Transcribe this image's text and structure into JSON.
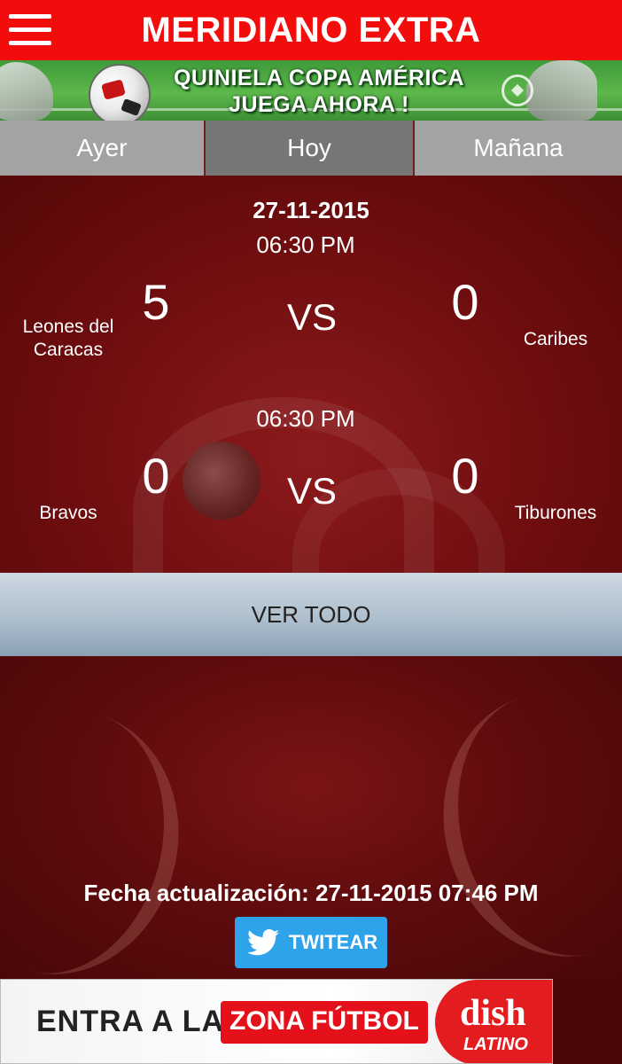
{
  "app": {
    "title": "MERIDIANO EXTRA"
  },
  "promo": {
    "line1": "QUINIELA COPA AMÉRICA",
    "line2": "JUEGA AHORA !"
  },
  "tabs": [
    {
      "label": "Ayer",
      "active": false
    },
    {
      "label": "Hoy",
      "active": true
    },
    {
      "label": "Mañana",
      "active": false
    }
  ],
  "date": "27-11-2015",
  "matches": [
    {
      "time": "06:30 PM",
      "home_team": "Leones del Caracas",
      "home_score": "5",
      "vs": "VS",
      "away_score": "0",
      "away_team": "Caribes"
    },
    {
      "time": "06:30 PM",
      "home_team": "Bravos",
      "home_score": "0",
      "vs": "VS",
      "away_score": "0",
      "away_team": "Tiburones"
    }
  ],
  "ver_todo": "VER TODO",
  "update": "Fecha actualización: 27-11-2015 07:46 PM",
  "twitter": {
    "label": "TWITEAR",
    "icon": "twitter-bird-icon"
  },
  "banner": {
    "entra": "ENTRA A LA",
    "zona": "ZONA FÚTBOL",
    "brand": "dish",
    "brand_sub": "LATINO"
  },
  "colors": {
    "header": "#f20c0c",
    "tab_active": "#767676",
    "tab_inactive": "#a3a3a3",
    "twitter": "#2fa3ea",
    "dish_red": "#e31c1f"
  }
}
